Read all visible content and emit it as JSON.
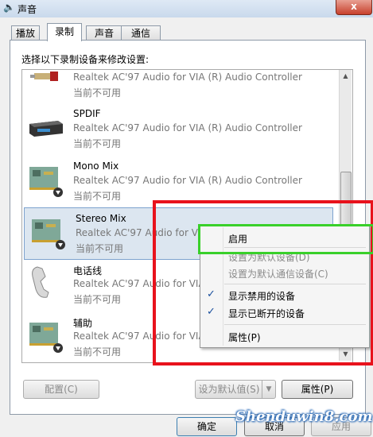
{
  "window": {
    "title": "声音",
    "close_glyph": "x"
  },
  "tabs": [
    {
      "label": "播放"
    },
    {
      "label": "录制",
      "active": true
    },
    {
      "label": "声音"
    },
    {
      "label": "通信"
    }
  ],
  "instruction": "选择以下录制设备来修改设置:",
  "devices": [
    {
      "name": "",
      "desc": "Realtek AC'97 Audio for VIA (R) Audio Controller",
      "status": "当前不可用",
      "icon": "audio-cable-icon"
    },
    {
      "name": "SPDIF",
      "desc": "Realtek AC'97 Audio for VIA (R) Audio Controller",
      "status": "当前不可用",
      "icon": "spdif-receiver-icon"
    },
    {
      "name": "Mono Mix",
      "desc": "Realtek AC'97 Audio for VIA (R) Audio Controller",
      "status": "当前不可用",
      "icon": "sound-card-icon"
    },
    {
      "name": "Stereo Mix",
      "desc": "Realtek AC'97 Audio for VIA (R) Audio Controller",
      "status": "当前不可用",
      "icon": "sound-card-icon"
    },
    {
      "name": "电话线",
      "desc": "Realtek AC'97 Audio for VIA (R) Audio Controller",
      "status": "当前不可用",
      "icon": "telephone-icon"
    },
    {
      "name": "辅助",
      "desc": "Realtek AC'97 Audio for VIA (R) Audio Controller",
      "status": "当前不可用",
      "icon": "sound-card-icon"
    }
  ],
  "context_menu": {
    "enable": "启用",
    "set_default": "设置为默认设备(D)",
    "set_default_comm": "设置为默认通信设备(C)",
    "show_disabled": "显示禁用的设备",
    "show_disconnected": "显示已断开的设备",
    "properties": "属性(P)",
    "check_glyph": "✓"
  },
  "buttons": {
    "configure": "配置(C)",
    "set_default": "设为默认值(S)",
    "dropdown_arrow": "▼",
    "properties": "属性(P)",
    "ok": "确定",
    "cancel": "取消",
    "apply": "应用"
  },
  "watermark": "Shenduwin8.com",
  "colors": {
    "annotation_red": "#e8121c",
    "annotation_green": "#39d02a",
    "selection": "#dce6f0"
  }
}
